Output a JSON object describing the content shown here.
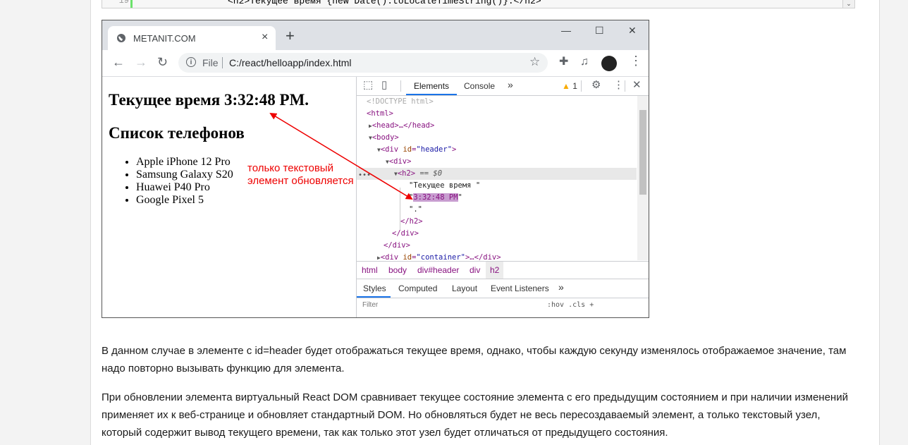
{
  "code_snippet": {
    "line_number": "19",
    "code_text": "<h2>Текущее время {new Date().toLocaleTimeString()}.</h2>"
  },
  "browser": {
    "tab_title": "METANIT.COM",
    "new_tab": "+",
    "minimize": "—",
    "maximize": "☐",
    "close": "✕",
    "protocol_label": "File",
    "url": "C:/react/helloapp/index.html"
  },
  "rendered_page": {
    "time_heading": "Текущее время 3:32:48 PM.",
    "list_heading": "Список телефонов",
    "phones": [
      "Apple iPhone 12 Pro",
      "Samsung Galaxy S20",
      "Huawei P40 Pro",
      "Google Pixel 5"
    ],
    "annotation_line1": "только текстовый",
    "annotation_line2": "элемент обновляется",
    "annotation_color": "#ff0000"
  },
  "devtools": {
    "tabs": [
      "Elements",
      "Console"
    ],
    "more_tabs": "»",
    "warning_count": "1",
    "dom": {
      "doctype": "<!DOCTYPE html>",
      "html_open": "<html>",
      "head": "<head>…</head>",
      "body_open": "<body>",
      "div_header_tag": "div",
      "div_header_attr": "id",
      "div_header_value": "\"header\"",
      "div_open": "<div>",
      "h2_open": "<h2>",
      "selected_marker": "== $0",
      "text1": "\"Текущее время \"",
      "text2_time": "3:32:48 PM",
      "text3": "\".\"",
      "h2_close": "</h2>",
      "div_close": "</div>",
      "div_container_attr": "id",
      "div_container_value": "\"container\"",
      "div_container_tail": ">…</div>"
    },
    "breadcrumbs": [
      "html",
      "body",
      "div#header",
      "div",
      "h2"
    ],
    "styles_tabs": [
      "Styles",
      "Computed",
      "Layout",
      "Event Listeners"
    ],
    "filter_placeholder": "Filter",
    "filter_right": ":hov  .cls  +"
  },
  "article": {
    "paragraph1": "В данном случае в элементе с id=header будет отображаться текущее время, однако, чтобы каждую секунду изменялось отображаемое значение, там надо повторно вызывать функцию для элемента.",
    "paragraph2": "При обновлении элемента виртуальный React DOM сравнивает текущее состояние элемента с его предыдущим состоянием и при наличии изменений применяет их к веб-странице и обновляет стандартный DOM. Но обновляться будет не весь пересоздаваемый элемент, а только текстовый узел, который содержит вывод текущего времени, так как только этот узел будет отличаться от предыдущего состояния."
  }
}
